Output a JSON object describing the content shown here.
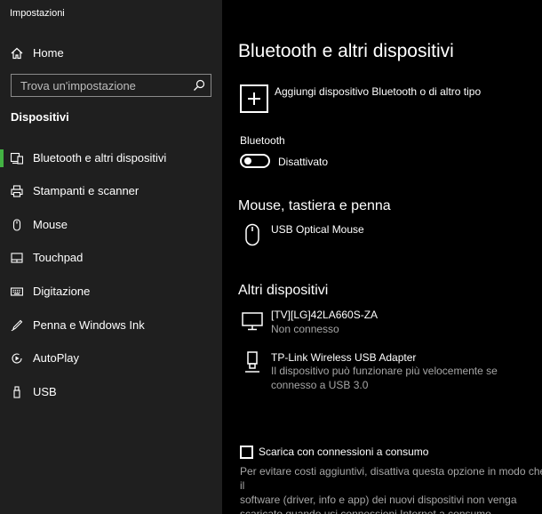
{
  "window": {
    "title": "Impostazioni"
  },
  "sidebar": {
    "home_label": "Home",
    "search_placeholder": "Trova un'impostazione",
    "section_title": "Dispositivi",
    "items": [
      {
        "label": "Bluetooth e altri dispositivi",
        "icon": "bluetooth-devices-icon",
        "selected": true
      },
      {
        "label": "Stampanti e scanner",
        "icon": "printer-icon",
        "selected": false
      },
      {
        "label": "Mouse",
        "icon": "mouse-icon",
        "selected": false
      },
      {
        "label": "Touchpad",
        "icon": "touchpad-icon",
        "selected": false
      },
      {
        "label": "Digitazione",
        "icon": "keyboard-icon",
        "selected": false
      },
      {
        "label": "Penna e Windows Ink",
        "icon": "pen-icon",
        "selected": false
      },
      {
        "label": "AutoPlay",
        "icon": "autoplay-icon",
        "selected": false
      },
      {
        "label": "USB",
        "icon": "usb-icon",
        "selected": false
      }
    ],
    "accent_color": "#43b243"
  },
  "main": {
    "title": "Bluetooth e altri dispositivi",
    "add_device_label": "Aggiungi dispositivo Bluetooth o di altro tipo",
    "bluetooth": {
      "label": "Bluetooth",
      "state_label": "Disattivato",
      "on": false
    },
    "mouse_section": {
      "title": "Mouse, tastiera e penna",
      "devices": [
        {
          "name": "USB Optical Mouse",
          "icon": "mouse-device-icon"
        }
      ]
    },
    "other_section": {
      "title": "Altri dispositivi",
      "devices": [
        {
          "name": "[TV][LG]42LA660S-ZA",
          "status": "Non connesso",
          "icon": "monitor-icon"
        },
        {
          "name": "TP-Link Wireless USB Adapter",
          "status_line1": "Il dispositivo può funzionare più velocemente se",
          "status_line2": "connesso a USB 3.0",
          "icon": "usb-adapter-icon"
        }
      ]
    },
    "metered": {
      "checkbox_label": "Scarica con connessioni a consumo",
      "checked": false,
      "desc_line1": "Per evitare costi aggiuntivi, disattiva questa opzione in modo che il",
      "desc_line2": "software (driver, info e app) dei nuovi dispositivi non venga",
      "desc_line3": "scaricato quando usi connessioni Internet a consumo."
    }
  }
}
